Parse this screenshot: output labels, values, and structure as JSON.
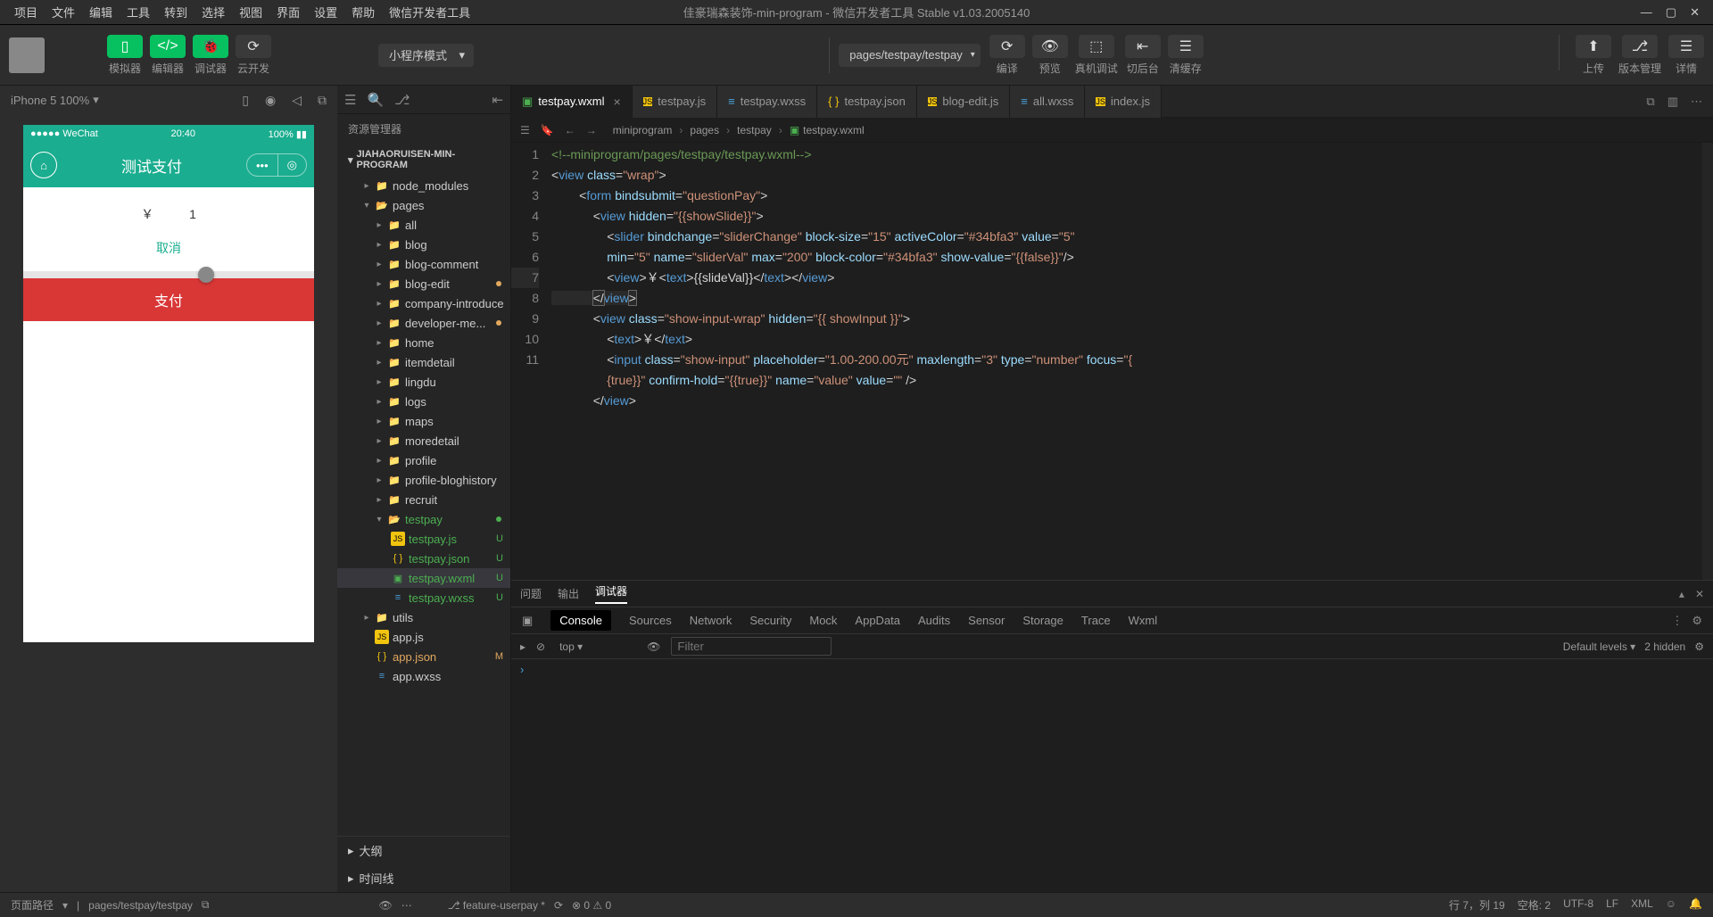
{
  "menu": [
    "项目",
    "文件",
    "编辑",
    "工具",
    "转到",
    "选择",
    "视图",
    "界面",
    "设置",
    "帮助",
    "微信开发者工具"
  ],
  "window_title": "佳豪瑞森装饰-min-program - 微信开发者工具 Stable v1.03.2005140",
  "toolbar": {
    "simulator": "模拟器",
    "editor": "编辑器",
    "debugger": "调试器",
    "cloud": "云开发",
    "mode": "小程序模式",
    "path": "pages/testpay/testpay",
    "compile": "编译",
    "preview": "预览",
    "remote": "真机调试",
    "background": "切后台",
    "clear": "清缓存",
    "upload": "上传",
    "version": "版本管理",
    "details": "详情"
  },
  "sim": {
    "device": "iPhone 5 100%",
    "signal": "●●●●● WeChat",
    "time": "20:40",
    "battery": "100%",
    "nav_title": "测试支付",
    "currency": "￥",
    "price": "1",
    "cancel": "取消",
    "pay": "支付"
  },
  "explorer": {
    "title": "资源管理器",
    "project": "JIAHAORUISEN-MIN-PROGRAM",
    "outline": "大纲",
    "timeline": "时间线"
  },
  "tree": {
    "node_modules": "node_modules",
    "pages": "pages",
    "all": "all",
    "blog": "blog",
    "blog_comment": "blog-comment",
    "blog_edit": "blog-edit",
    "company_introduce": "company-introduce",
    "developer_me": "developer-me...",
    "home": "home",
    "itemdetail": "itemdetail",
    "lingdu": "lingdu",
    "logs": "logs",
    "maps": "maps",
    "moredetail": "moredetail",
    "profile": "profile",
    "profile_bloghistory": "profile-bloghistory",
    "recruit": "recruit",
    "testpay": "testpay",
    "testpay_js": "testpay.js",
    "testpay_json": "testpay.json",
    "testpay_wxml": "testpay.wxml",
    "testpay_wxss": "testpay.wxss",
    "utils": "utils",
    "app_js": "app.js",
    "app_json": "app.json",
    "app_wxss": "app.wxss"
  },
  "tabs": {
    "t1": "testpay.wxml",
    "t2": "testpay.js",
    "t3": "testpay.wxss",
    "t4": "testpay.json",
    "t5": "blog-edit.js",
    "t6": "all.wxss",
    "t7": "index.js"
  },
  "breadcrumb": {
    "b1": "miniprogram",
    "b2": "pages",
    "b3": "testpay",
    "b4": "testpay.wxml"
  },
  "code_lines": [
    "1",
    "2",
    "3",
    "4",
    "5",
    "6",
    "7",
    "8",
    "9",
    "10",
    "11"
  ],
  "devtools": {
    "outer": {
      "problems": "问题",
      "output": "输出",
      "debugger": "调试器"
    },
    "tabs": {
      "console": "Console",
      "sources": "Sources",
      "network": "Network",
      "security": "Security",
      "mock": "Mock",
      "appdata": "AppData",
      "audits": "Audits",
      "sensor": "Sensor",
      "storage": "Storage",
      "trace": "Trace",
      "wxml": "Wxml"
    },
    "context": "top",
    "filter": "Filter",
    "levels": "Default levels",
    "hidden": "2 hidden"
  },
  "git_branch": "feature-userpay *",
  "git_stats": "⊗ 0 ⚠ 0",
  "bottom": {
    "path_label": "页面路径",
    "path": "pages/testpay/testpay",
    "cursor": "行 7，列 19",
    "spaces": "空格: 2",
    "encoding": "UTF-8",
    "eol": "LF",
    "lang": "XML"
  }
}
